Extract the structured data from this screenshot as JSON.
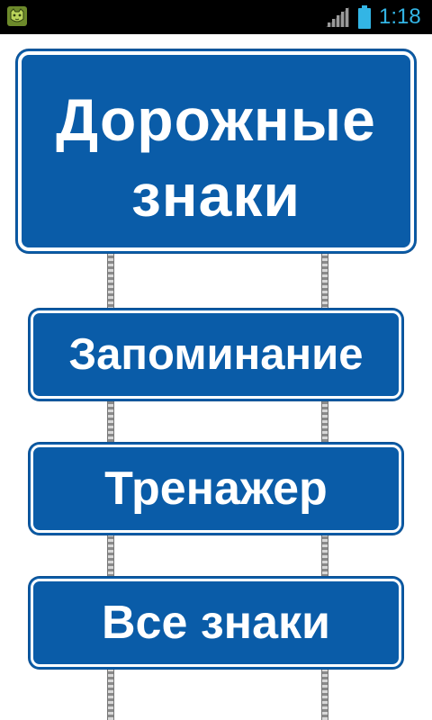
{
  "status_bar": {
    "time": "1:18",
    "app_icon": "cat-face-icon",
    "signal_icon": "signal-bars-icon",
    "battery_icon": "battery-icon",
    "accent_color": "#33b5e5"
  },
  "title_sign": {
    "line1": "Дорожные",
    "line2": "знаки"
  },
  "menu": {
    "items": [
      {
        "label": "Запоминание"
      },
      {
        "label": "Тренажер"
      },
      {
        "label": "Все знаки"
      }
    ]
  },
  "colors": {
    "sign_blue": "#0a5ca8",
    "sign_text": "#ffffff"
  }
}
